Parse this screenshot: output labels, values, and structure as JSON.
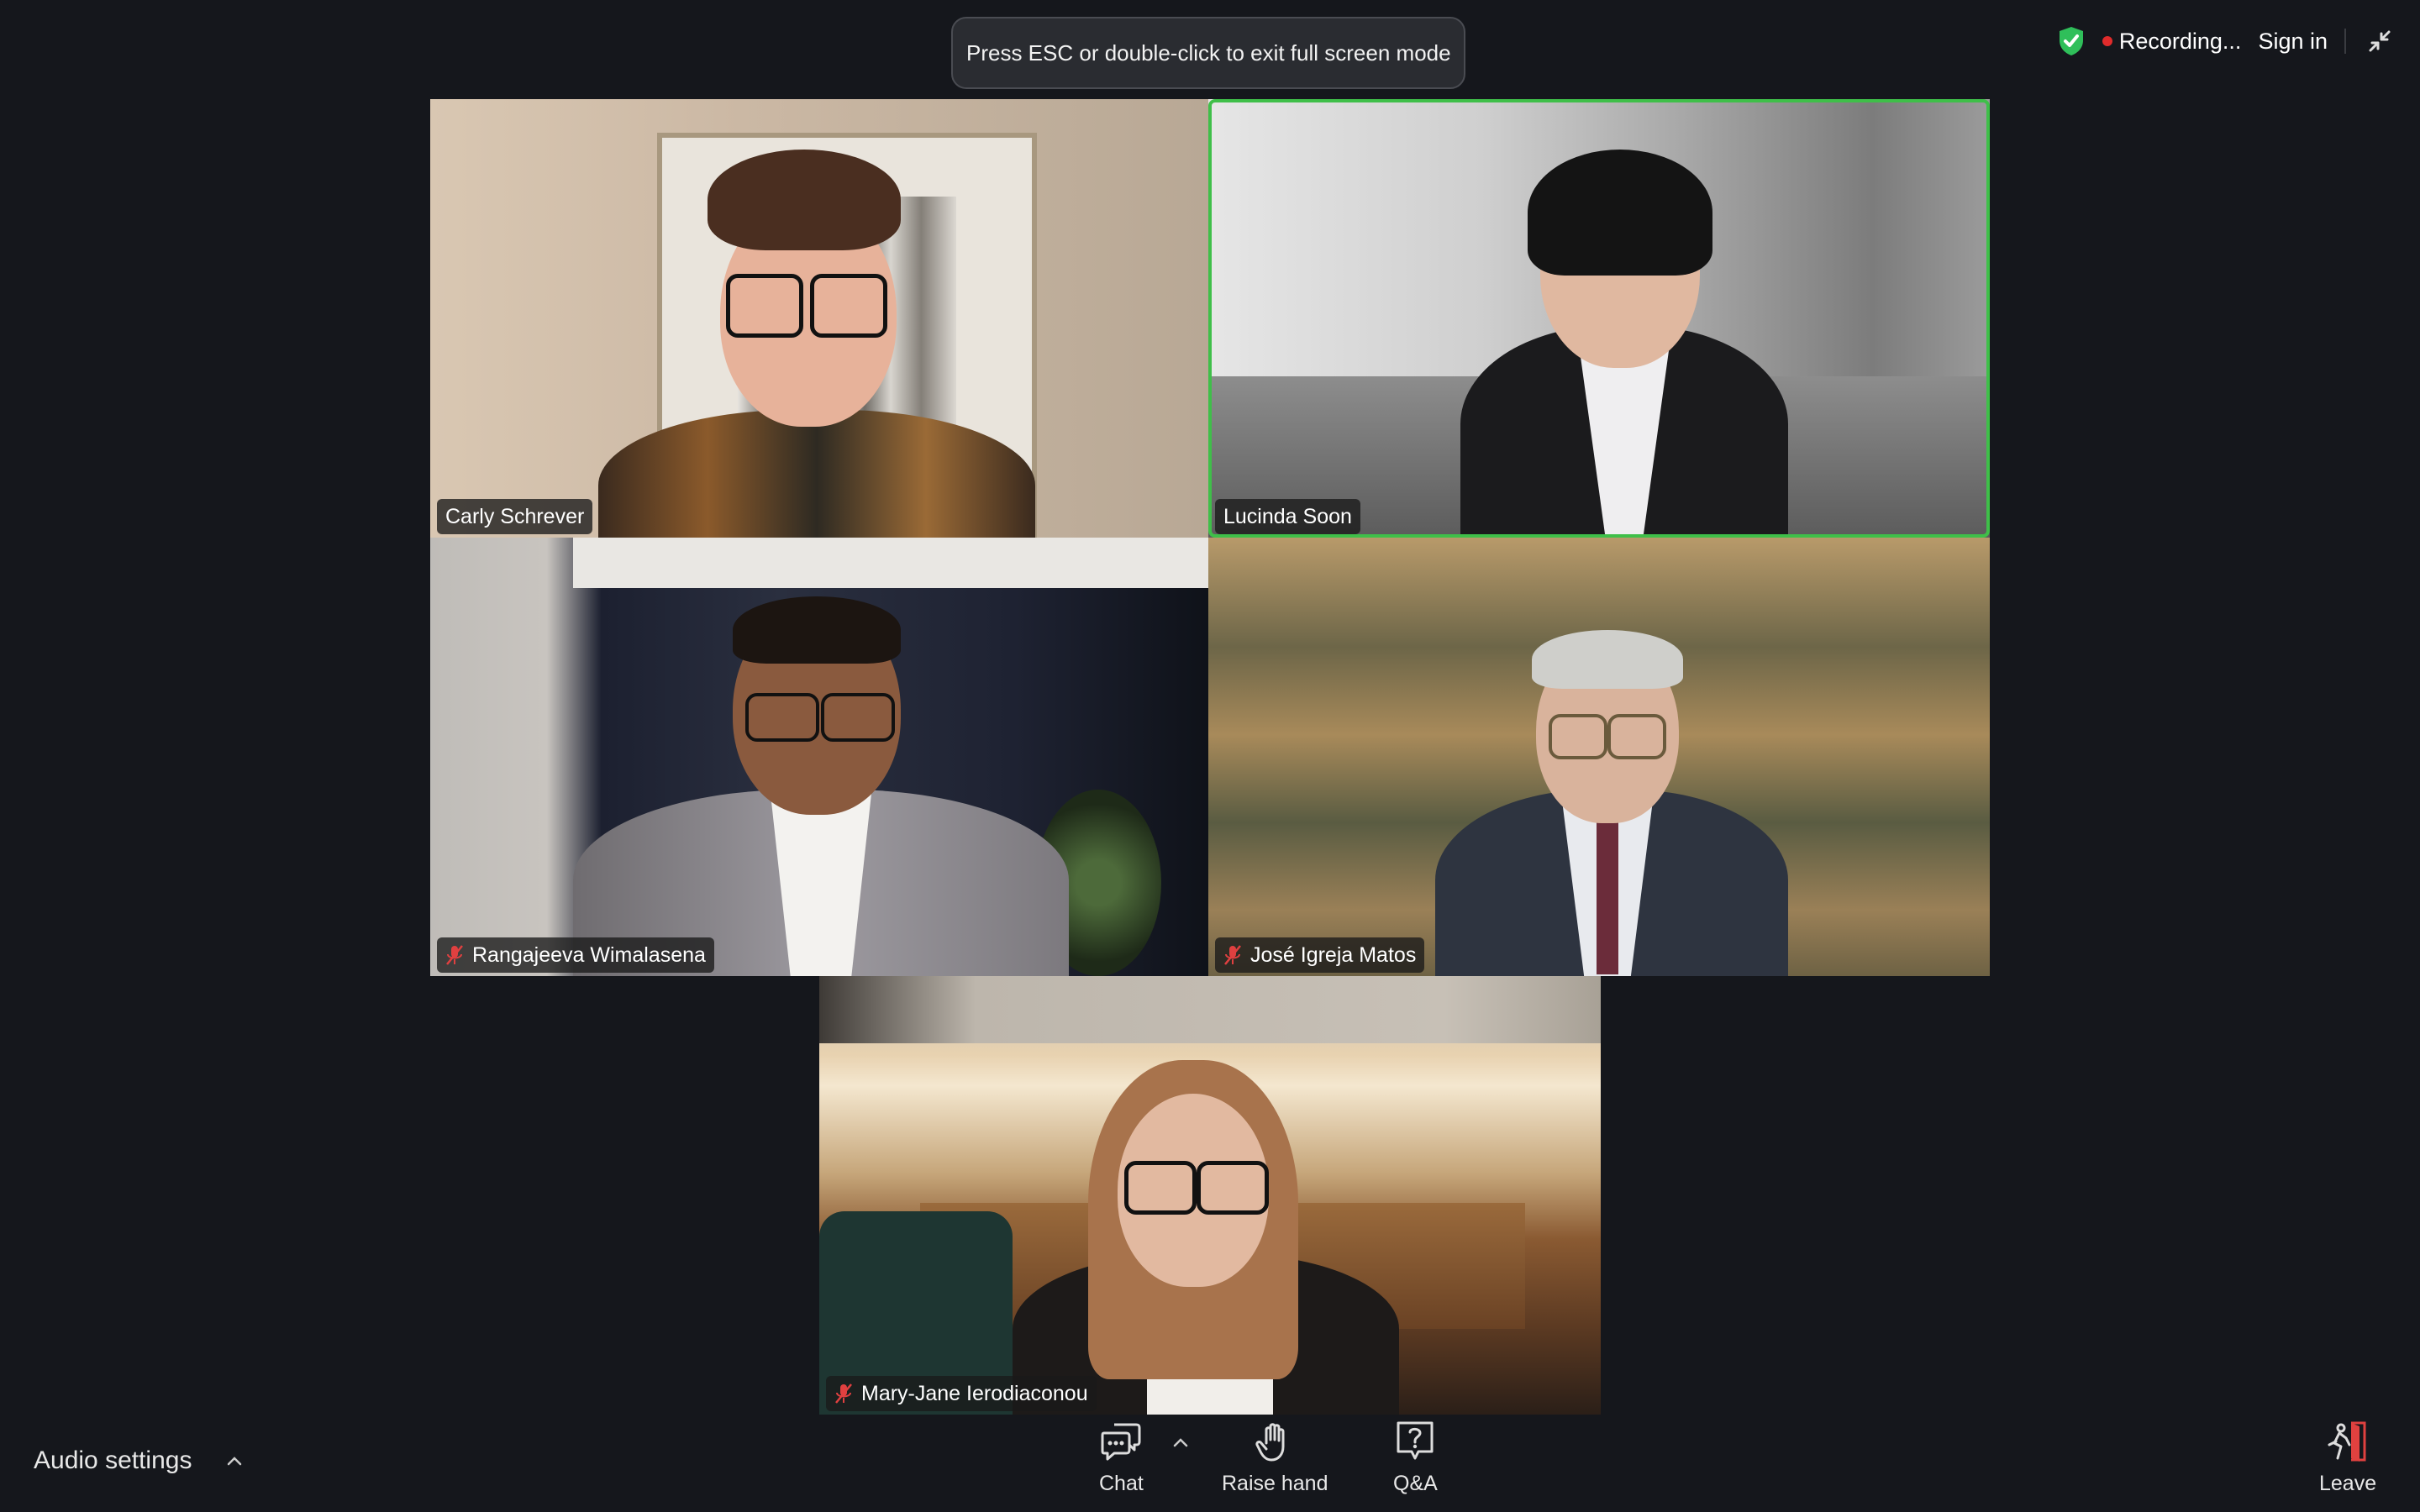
{
  "banner": {
    "text": "Press ESC or double-click to exit full screen mode"
  },
  "topbar": {
    "recording_label": "Recording...",
    "sign_in_label": "Sign in"
  },
  "participants": [
    {
      "name": "Carly Schrever",
      "muted": false,
      "active_speaker": false
    },
    {
      "name": "Lucinda Soon",
      "muted": false,
      "active_speaker": true
    },
    {
      "name": "Rangajeeva Wimalasena",
      "muted": true,
      "active_speaker": false
    },
    {
      "name": "José Igreja Matos",
      "muted": true,
      "active_speaker": false
    },
    {
      "name": "Mary-Jane Ierodiaconou",
      "muted": true,
      "active_speaker": false
    }
  ],
  "toolbar": {
    "audio_settings_label": "Audio settings",
    "chat_label": "Chat",
    "raise_hand_label": "Raise hand",
    "qa_label": "Q&A",
    "leave_label": "Leave"
  },
  "icons": {
    "security": "shield-check-icon",
    "recording": "recording-dot-icon",
    "exit_fullscreen": "exit-fullscreen-icon",
    "muted": "microphone-muted-icon",
    "chat": "chat-bubble-icon",
    "raise_hand": "hand-icon",
    "qa": "question-box-icon",
    "leave": "leave-door-icon"
  },
  "colors": {
    "background": "#15171c",
    "active_speaker_border": "#3fbf49",
    "recording_dot": "#e02b2b",
    "security_shield": "#2fbf5a",
    "muted_icon": "#e04040",
    "leave_icon": "#e0413f"
  }
}
